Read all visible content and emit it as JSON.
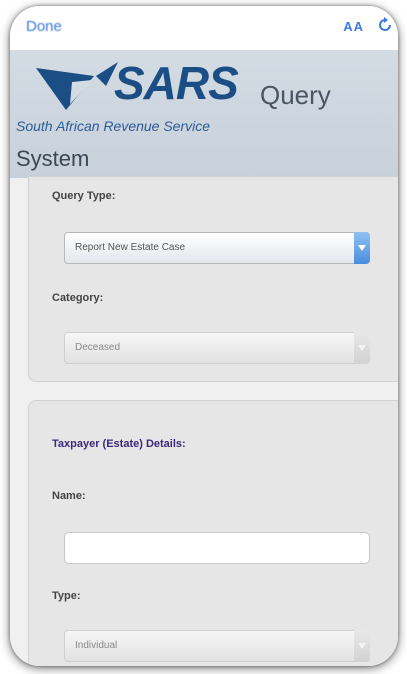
{
  "topbar": {
    "done_label": "Done",
    "text_size_label": "AA"
  },
  "header": {
    "logo_text": "SARS",
    "tagline": "South African Revenue Service",
    "title_part1": "Query",
    "title_part2": "System"
  },
  "form": {
    "query_type_label": "Query Type:",
    "query_type_value": "Report New Estate Case",
    "category_label": "Category:",
    "category_value": "Deceased",
    "taxpayer_heading": "Taxpayer (Estate) Details:",
    "name_label": "Name:",
    "name_value": "",
    "type_label": "Type:",
    "type_value": "Individual"
  },
  "colors": {
    "link_blue": "#3a7ae0",
    "brand_blue": "#1c4e86",
    "header_bg": "#c8d1da",
    "heading_purple": "#3a2a7a"
  },
  "icons": [
    "reload-icon",
    "sars-logo-mark",
    "dropdown-arrow-icon"
  ]
}
